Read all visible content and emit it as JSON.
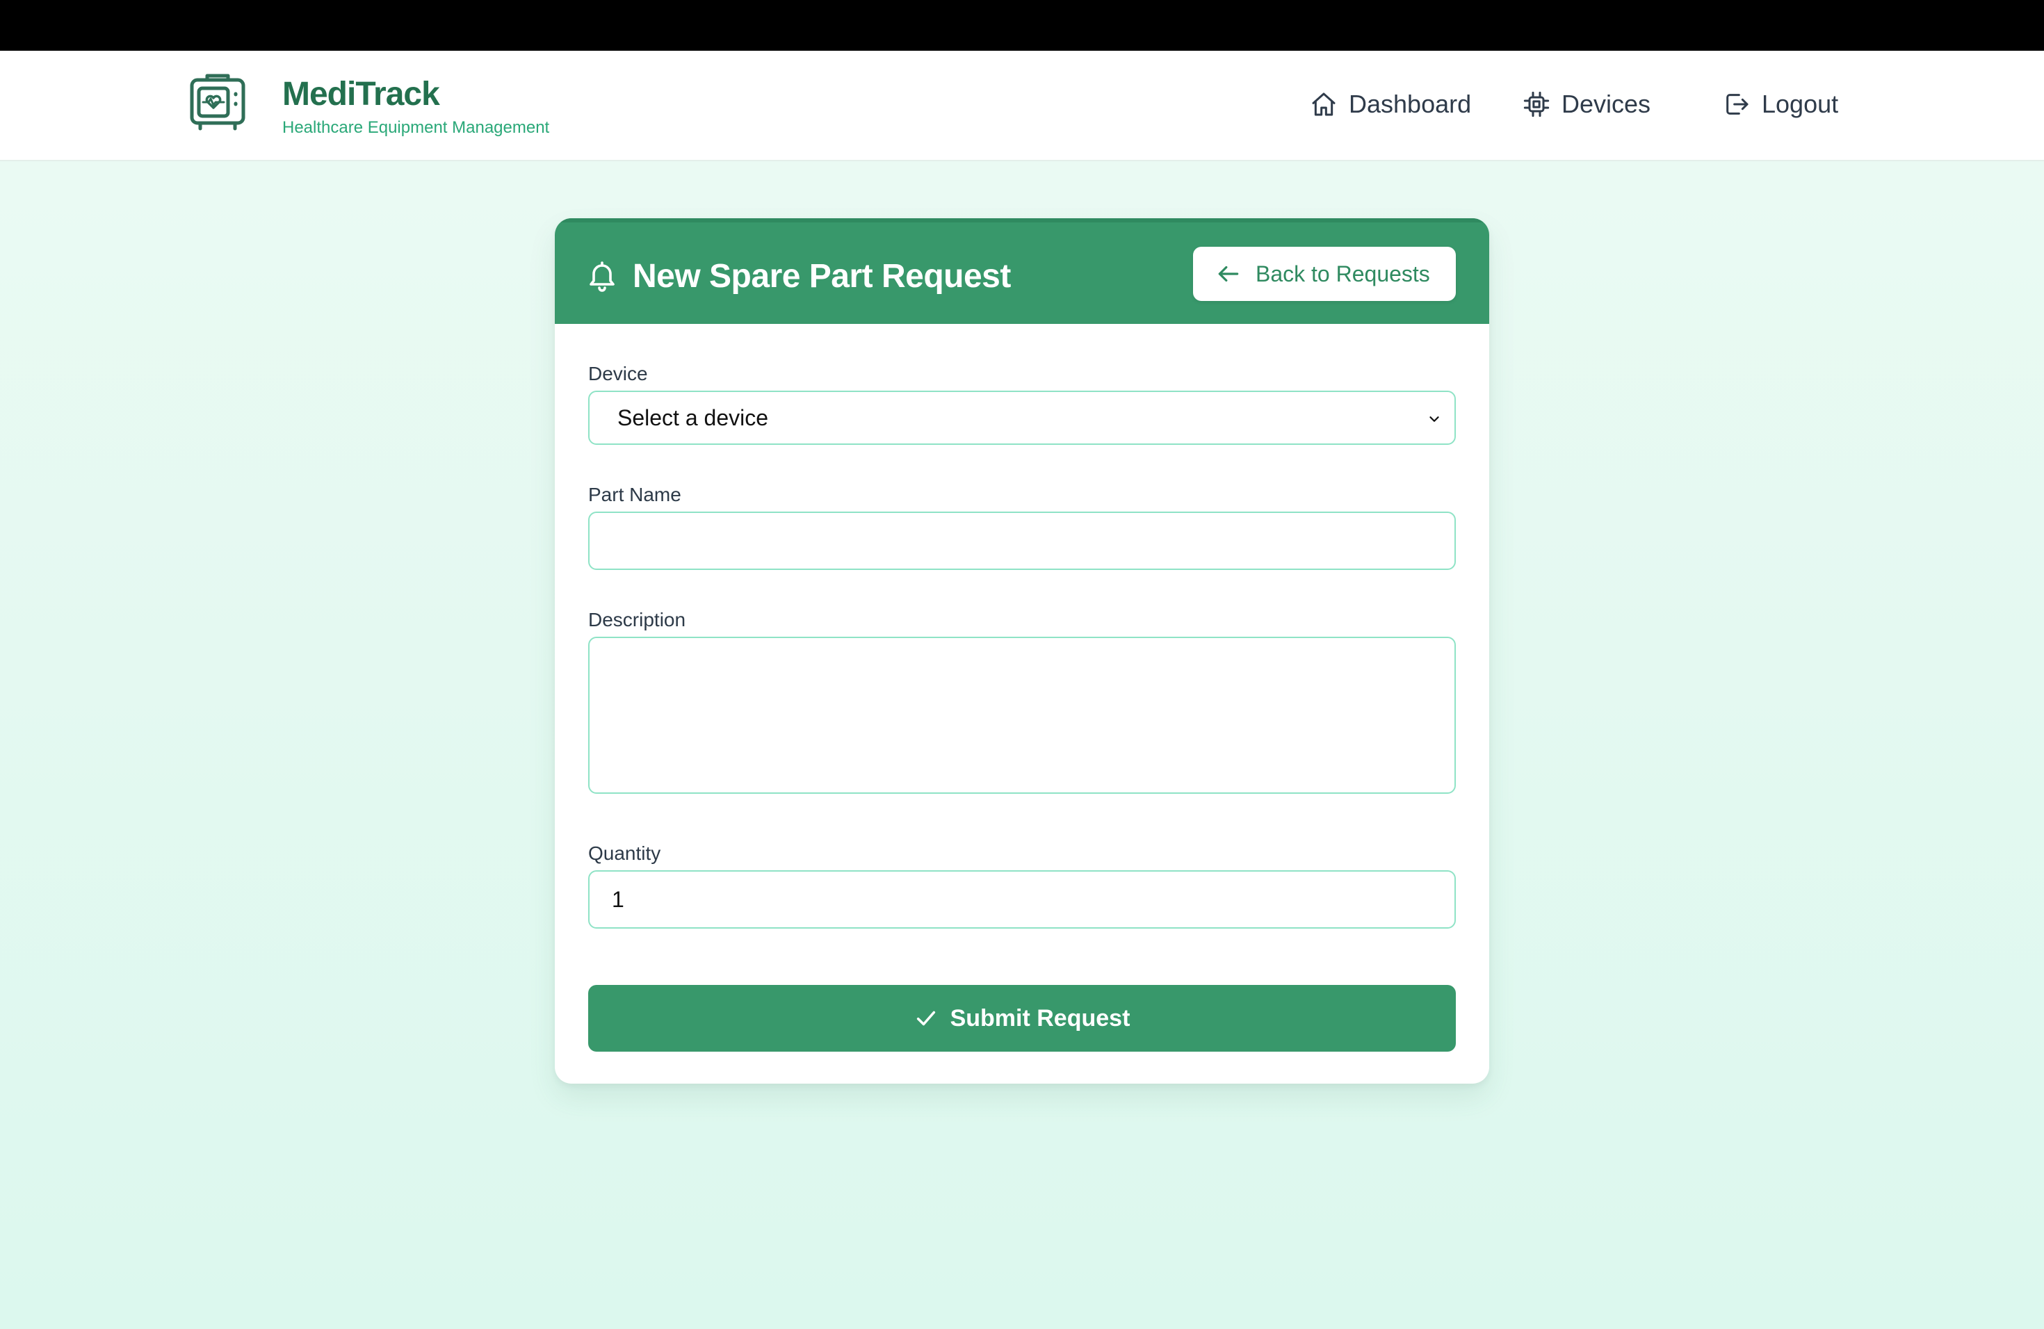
{
  "app": {
    "name": "MediTrack",
    "tagline": "Healthcare Equipment Management",
    "logo_icon": "medical-monitor-icon"
  },
  "nav": {
    "items": [
      {
        "label": "Dashboard",
        "icon": "home-icon"
      },
      {
        "label": "Devices",
        "icon": "chip-icon"
      },
      {
        "label": "Logout",
        "icon": "logout-icon"
      }
    ]
  },
  "form": {
    "title": "New Spare Part Request",
    "title_icon": "bell-icon",
    "back_label": "Back to Requests",
    "device": {
      "label": "Device",
      "value": "Select a device"
    },
    "part_name": {
      "label": "Part Name",
      "value": ""
    },
    "description": {
      "label": "Description",
      "value": ""
    },
    "quantity": {
      "label": "Quantity",
      "value": "1"
    },
    "submit_label": "Submit Request"
  },
  "colors": {
    "primary": "#38986b",
    "brand_text": "#23704e",
    "tagline": "#2aa878",
    "input_border": "#8fe3c6",
    "background": "#e6faf2"
  }
}
